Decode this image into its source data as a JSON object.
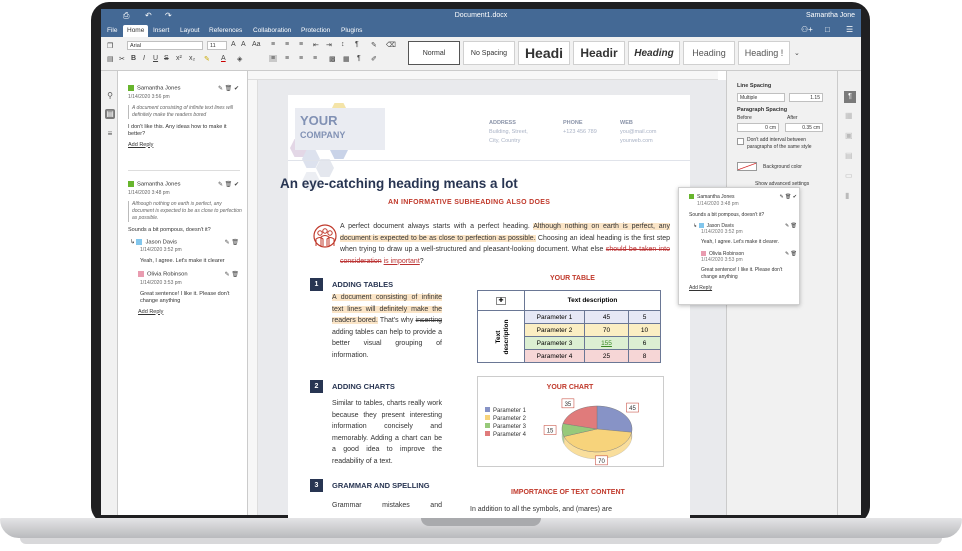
{
  "app": {
    "doc_title": "Document1.docx",
    "user_name": "Samantha Jone"
  },
  "tabs": [
    "File",
    "Home",
    "Insert",
    "Layout",
    "References",
    "Collaboration",
    "Protection",
    "Plugins"
  ],
  "toolbar": {
    "font_name": "Arial",
    "font_size": "11",
    "styles": [
      "Normal",
      "No Spacing",
      "Headi",
      "Headir",
      "Heading",
      "Heading",
      "Heading !"
    ]
  },
  "comments_panel": [
    {
      "author": "Samantha Jones",
      "date": "1/14/2020 3:56 pm",
      "quote": "A document consisting of infinite text lines will definitely make the readers bored",
      "text": "I don't like this. Any ideas how to make it better?",
      "reply_link": "Add Reply",
      "color": "#67b52d"
    },
    {
      "author": "Samantha Jones",
      "date": "1/14/2020 3:48 pm",
      "quote": "Although nothing on earth is perfect, any document is expected to be as close to perfection as possible.",
      "text": "Sounds a bit pompous, doesn't it?",
      "color": "#67b52d",
      "replies": [
        {
          "author": "Jason Davis",
          "date": "1/14/2020 3:52 pm",
          "text": "Yeah, I agree. Let's make it clearer",
          "color": "#82c6ec"
        },
        {
          "author": "Olivia Robinson",
          "date": "1/14/2020 3:53 pm",
          "text": "Great sentence! I like it. Please don't change anything",
          "color": "#e99cb0"
        }
      ],
      "reply_link": "Add Reply"
    }
  ],
  "page": {
    "company_line1": "YOUR",
    "company_line2": "COMPANY",
    "contact_heads": [
      "ADDRESS",
      "PHONE",
      "WEB"
    ],
    "address": [
      "Building, Street,",
      "City, Country"
    ],
    "phone": "+123 456 789",
    "web": [
      "you@mail.com",
      "yourweb.com"
    ],
    "heading": "An eye-catching heading means a lot",
    "subheading": "AN INFORMATIVE SUBHEADING ALSO DOES",
    "intro_1": "A perfect document always starts with a perfect heading.",
    "intro_hl": "Although nothing on earth is perfect, any document is expected to be as close to perfection as possible.",
    "intro_2": "Choosing an ideal heading is the first step when trying to draw up a well-structured and pleasant-looking document. What else",
    "intro_strike": "should be taken into consideration",
    "intro_ul": "is important",
    "intro_end": "?",
    "sections": [
      {
        "num": "1",
        "title": "ADDING TABLES",
        "hl": "A document consisting of infinite text lines will definitely make the readers bored.",
        "body_1": "That's why",
        "strike": "inserting",
        "body_2": "adding tables can help to provide a better visual grouping of information."
      },
      {
        "num": "2",
        "title": "ADDING CHARTS",
        "body": "Similar to tables, charts really work because they present interesting information concisely and memorably. Adding a chart can be a good idea to improve the readability of a text."
      },
      {
        "num": "3",
        "title": "GRAMMAR AND SPELLING",
        "body": "Grammar mistakes and"
      }
    ],
    "table_title": "YOUR TABLE",
    "table": {
      "header": "Text description",
      "row_label": "Text description",
      "rows": [
        [
          "Parameter 1",
          "45",
          "5"
        ],
        [
          "Parameter 2",
          "70",
          "10"
        ],
        [
          "Parameter 3",
          "155",
          "6"
        ],
        [
          "Parameter 4",
          "25",
          "8"
        ]
      ]
    },
    "chart_title": "YOUR CHART",
    "importance_title": "IMPORTANCE OF TEXT CONTENT",
    "importance_body": "In addition to all the symbols, and (mares) are"
  },
  "chart_data": {
    "type": "pie",
    "title": "YOUR CHART",
    "categories": [
      "Parameter 1",
      "Parameter 2",
      "Parameter 3",
      "Parameter 4"
    ],
    "values": [
      45,
      70,
      15,
      35
    ],
    "colors": [
      "#8793c6",
      "#f7d37b",
      "#97c97a",
      "#e07b7b"
    ],
    "legend": "left"
  },
  "popup_comment": {
    "author": "Samantha Jones",
    "date": "1/14/2020 3:48 pm",
    "text": "Sounds a bit pompous, doesn't it?",
    "replies": [
      {
        "author": "Jason Davis",
        "date": "1/14/2020 3:52 pm",
        "text": "Yeah, I agree. Let's make it clearer."
      },
      {
        "author": "Olivia Robinson",
        "date": "1/14/2020 3:53 pm",
        "text": "Great sentence! I like it. Please don't change anything"
      }
    ],
    "reply_link": "Add Reply"
  },
  "right_panel": {
    "line_spacing_label": "Line Spacing",
    "line_spacing_mode": "Multiple",
    "line_spacing_value": "1.15",
    "para_spacing_label": "Paragraph Spacing",
    "before_label": "Before",
    "after_label": "After",
    "before_value": "0 cm",
    "after_value": "0.35 cm",
    "no_interval_text": "Don't add interval between paragraphs of the same style",
    "bg_color_label": "Background color",
    "advanced_link": "Show advanced settings"
  },
  "colors": {
    "titlebar": "#446995",
    "heading": "#283552",
    "accent_red": "#c0392b",
    "highlight": "#fbe5c7"
  }
}
